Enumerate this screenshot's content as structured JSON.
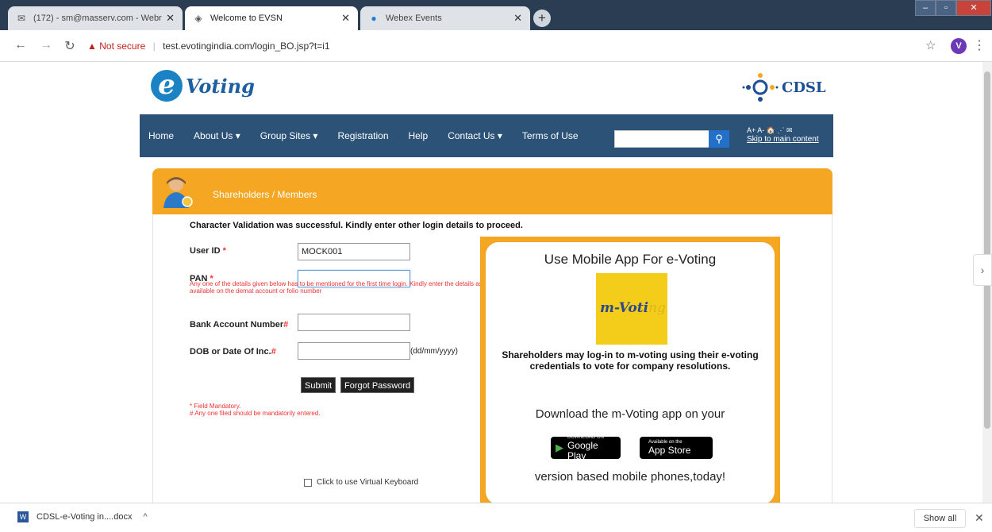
{
  "browser": {
    "tabs": [
      {
        "title": "(172) - sm@masserv.com - Webr",
        "icon": "mail-icon"
      },
      {
        "title": "Welcome to EVSN",
        "icon": "diamond-icon"
      },
      {
        "title": "Webex Events",
        "icon": "webex-icon"
      }
    ],
    "security_label": "Not secure",
    "url": "test.evotingindia.com/login_BO.jsp?t=i1",
    "profile_initial": "V",
    "download": {
      "name": "CDSL-e-Voting in....docx",
      "show_all": "Show all"
    }
  },
  "site": {
    "logo_left": "Voting",
    "logo_right": "CDSL",
    "nav": [
      "Home",
      "About Us ▾",
      "Group Sites ▾",
      "Registration",
      "Help",
      "Contact Us ▾",
      "Terms of Use"
    ],
    "tools_row": "A+  A-  🏠  ⋰  ✉",
    "skip_link": "Skip to main content",
    "colors": {
      "nav": "#2c5377",
      "panel": "#f5a623",
      "required": "#e33333"
    }
  },
  "panel": {
    "title": "Shareholders / Members",
    "message": "Character Validation was successful. Kindly enter other login details to proceed.",
    "fields": {
      "user_id_label": "User ID",
      "user_id_value": "MOCK001",
      "pan_label": "PAN",
      "pan_help": "Any one of the details given below has to be mentioned for the first time login. Kindly enter the details as available on the demat account or folio number",
      "bank_label": "Bank Account Number",
      "dob_label": "DOB or Date Of Inc.",
      "dob_format": "(dd/mm/yyyy)"
    },
    "required_mark": "*",
    "hash_mark": "#",
    "submit": "Submit",
    "forgot": "Forgot Password",
    "note1": "* Field Mandatory.",
    "note2": "# Any one filed should be mandatorily entered.",
    "virtual_keyboard": "Click to use Virtual Keyboard"
  },
  "promo": {
    "heading": "Use Mobile App For e-Voting",
    "logo_text_main": "m-Voti",
    "logo_text_tail": "ng",
    "description": "Shareholders may log-in to m-voting using their e-voting credentials to vote for company resolutions.",
    "download_text": "Download the m-Voting app on your",
    "google_small": "DOWNLOAD ON",
    "google_big": "Google Play",
    "apple_small": "Available on the",
    "apple_big": "App Store",
    "footer_text": "version based mobile phones,today!"
  }
}
